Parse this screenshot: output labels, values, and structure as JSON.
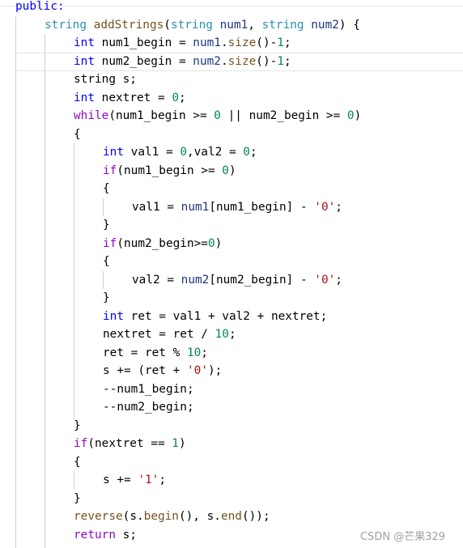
{
  "code_lines": [
    {
      "indent": 0,
      "tokens": [
        [
          "public:",
          "kw"
        ]
      ]
    },
    {
      "indent": 1,
      "tokens": [
        [
          "string",
          "type"
        ],
        [
          " ",
          "plain"
        ],
        [
          "addStrings",
          "fn"
        ],
        [
          "(",
          "plain"
        ],
        [
          "string",
          "type"
        ],
        [
          " ",
          "plain"
        ],
        [
          "num1",
          "param"
        ],
        [
          ", ",
          "plain"
        ],
        [
          "string",
          "type"
        ],
        [
          " ",
          "plain"
        ],
        [
          "num2",
          "param"
        ],
        [
          ") {",
          "plain"
        ]
      ]
    },
    {
      "indent": 2,
      "tokens": [
        [
          "int",
          "kw"
        ],
        [
          " num1_begin = ",
          "plain"
        ],
        [
          "num1",
          "param"
        ],
        [
          ".",
          "plain"
        ],
        [
          "size",
          "fn"
        ],
        [
          "()-",
          "plain"
        ],
        [
          "1",
          "num"
        ],
        [
          ";",
          "plain"
        ]
      ]
    },
    {
      "indent": 2,
      "tokens": [
        [
          "int",
          "kw"
        ],
        [
          " num2_begin = ",
          "plain"
        ],
        [
          "num2",
          "param"
        ],
        [
          ".",
          "plain"
        ],
        [
          "size",
          "fn"
        ],
        [
          "()-",
          "plain"
        ],
        [
          "1",
          "num"
        ],
        [
          ";",
          "plain"
        ]
      ]
    },
    {
      "indent": 2,
      "tokens": [
        [
          "string",
          "plain"
        ],
        [
          " s;",
          "plain"
        ]
      ]
    },
    {
      "indent": 2,
      "tokens": [
        [
          "int",
          "kw"
        ],
        [
          " nextret = ",
          "plain"
        ],
        [
          "0",
          "num"
        ],
        [
          ";",
          "plain"
        ]
      ]
    },
    {
      "indent": 2,
      "tokens": [
        [
          "while",
          "ctl"
        ],
        [
          "(num1_begin >= ",
          "plain"
        ],
        [
          "0",
          "num"
        ],
        [
          " || num2_begin >= ",
          "plain"
        ],
        [
          "0",
          "num"
        ],
        [
          ")",
          "plain"
        ]
      ]
    },
    {
      "indent": 2,
      "tokens": [
        [
          "{",
          "plain"
        ]
      ]
    },
    {
      "indent": 3,
      "tokens": [
        [
          "int",
          "kw"
        ],
        [
          " val1 = ",
          "plain"
        ],
        [
          "0",
          "num"
        ],
        [
          ",val2 = ",
          "plain"
        ],
        [
          "0",
          "num"
        ],
        [
          ";",
          "plain"
        ]
      ]
    },
    {
      "indent": 3,
      "tokens": [
        [
          "if",
          "ctl"
        ],
        [
          "(num1_begin >= ",
          "plain"
        ],
        [
          "0",
          "num"
        ],
        [
          ")",
          "plain"
        ]
      ]
    },
    {
      "indent": 3,
      "tokens": [
        [
          "{",
          "plain"
        ]
      ]
    },
    {
      "indent": 4,
      "tokens": [
        [
          "val1 = ",
          "plain"
        ],
        [
          "num1",
          "param"
        ],
        [
          "[num1_begin] - ",
          "plain"
        ],
        [
          "'0'",
          "str"
        ],
        [
          ";",
          "plain"
        ]
      ]
    },
    {
      "indent": 3,
      "tokens": [
        [
          "}",
          "plain"
        ]
      ]
    },
    {
      "indent": 3,
      "tokens": [
        [
          "if",
          "ctl"
        ],
        [
          "(num2_begin>=",
          "plain"
        ],
        [
          "0",
          "num"
        ],
        [
          ")",
          "plain"
        ]
      ]
    },
    {
      "indent": 3,
      "tokens": [
        [
          "{",
          "plain"
        ]
      ]
    },
    {
      "indent": 4,
      "tokens": [
        [
          "val2 = ",
          "plain"
        ],
        [
          "num2",
          "param"
        ],
        [
          "[num2_begin] - ",
          "plain"
        ],
        [
          "'0'",
          "str"
        ],
        [
          ";",
          "plain"
        ]
      ]
    },
    {
      "indent": 3,
      "tokens": [
        [
          "}",
          "plain"
        ]
      ]
    },
    {
      "indent": 3,
      "tokens": [
        [
          "int",
          "kw"
        ],
        [
          " ret = val1 + val2 + nextret;",
          "plain"
        ]
      ]
    },
    {
      "indent": 3,
      "tokens": [
        [
          "nextret = ret / ",
          "plain"
        ],
        [
          "10",
          "num"
        ],
        [
          ";",
          "plain"
        ]
      ]
    },
    {
      "indent": 3,
      "tokens": [
        [
          "ret = ret % ",
          "plain"
        ],
        [
          "10",
          "num"
        ],
        [
          ";",
          "plain"
        ]
      ]
    },
    {
      "indent": 3,
      "tokens": [
        [
          "s += (ret + ",
          "plain"
        ],
        [
          "'0'",
          "str"
        ],
        [
          ");",
          "plain"
        ]
      ]
    },
    {
      "indent": 3,
      "tokens": [
        [
          "--num1_begin;",
          "plain"
        ]
      ]
    },
    {
      "indent": 3,
      "tokens": [
        [
          "--num2_begin;",
          "plain"
        ]
      ]
    },
    {
      "indent": 2,
      "tokens": [
        [
          "}",
          "plain"
        ]
      ]
    },
    {
      "indent": 2,
      "tokens": [
        [
          "if",
          "ctl"
        ],
        [
          "(nextret == ",
          "plain"
        ],
        [
          "1",
          "num"
        ],
        [
          ")",
          "plain"
        ]
      ]
    },
    {
      "indent": 2,
      "tokens": [
        [
          "{",
          "plain"
        ]
      ]
    },
    {
      "indent": 3,
      "tokens": [
        [
          "s += ",
          "plain"
        ],
        [
          "'1'",
          "str"
        ],
        [
          ";",
          "plain"
        ]
      ]
    },
    {
      "indent": 2,
      "tokens": [
        [
          "}",
          "plain"
        ]
      ]
    },
    {
      "indent": 2,
      "tokens": [
        [
          "reverse",
          "fn"
        ],
        [
          "(s.",
          "plain"
        ],
        [
          "begin",
          "fn"
        ],
        [
          "(), s.",
          "plain"
        ],
        [
          "end",
          "fn"
        ],
        [
          "());",
          "plain"
        ]
      ]
    },
    {
      "indent": 2,
      "tokens": [
        [
          "return",
          "ctl"
        ],
        [
          " s;",
          "plain"
        ]
      ]
    }
  ],
  "watermark": "CSDN @芒果329",
  "colors": {
    "keyword": "#0000ff",
    "type": "#2b91af",
    "function": "#74531f",
    "control": "#8f08c4",
    "number": "#098658",
    "string": "#a31515",
    "parameter": "#1f377f"
  }
}
